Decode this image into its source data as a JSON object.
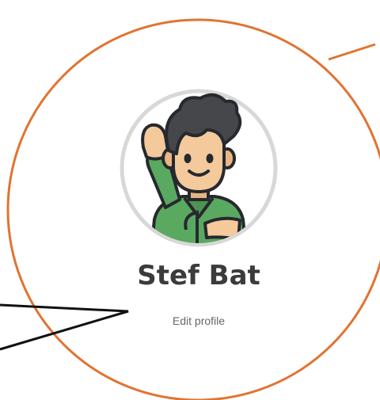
{
  "profile": {
    "name": "Stef Bat",
    "edit_link": "Edit profile",
    "avatar_icon": "cartoon-boy-waving-avatar"
  },
  "colors": {
    "callout_circle": "#e07432",
    "callout_line": "#111111",
    "name_text": "#3b3b3b",
    "link_text": "#666666",
    "shirt": "#5aa960",
    "hair": "#46474b",
    "skin": "#f4c99b"
  }
}
